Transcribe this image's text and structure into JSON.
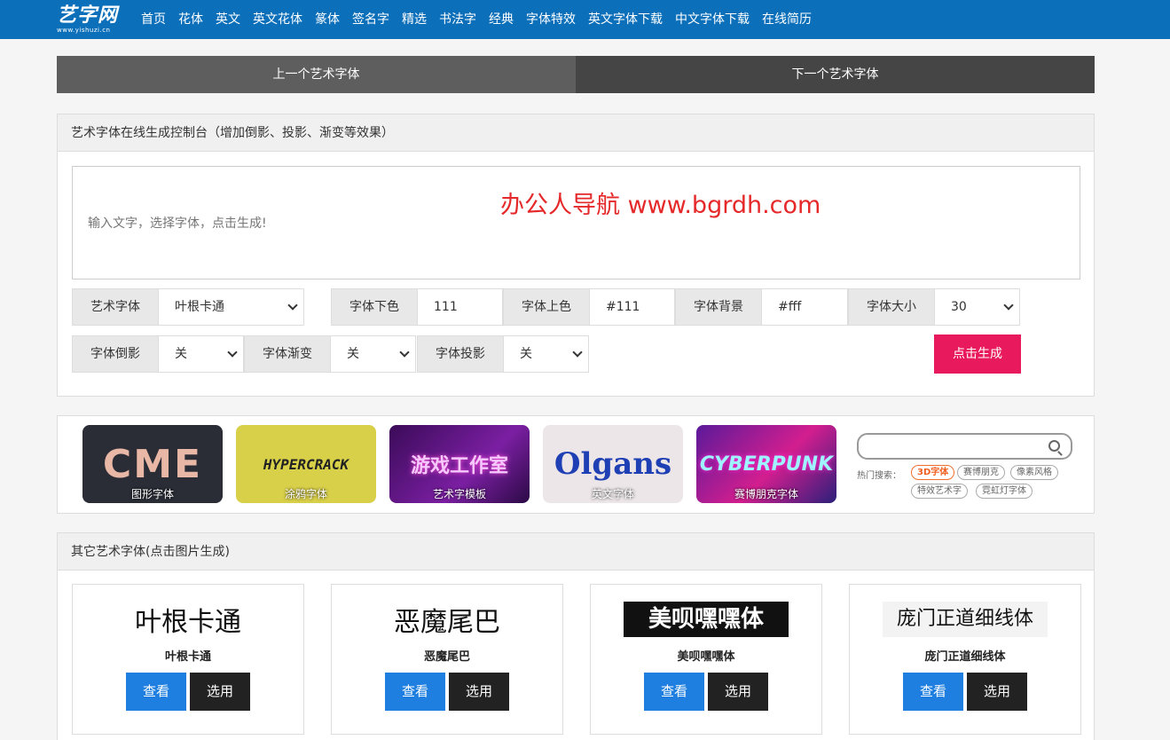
{
  "header": {
    "logo_text": "艺字网",
    "logo_sub": "www.yishuzi.cn",
    "nav": [
      "首页",
      "花体",
      "英文",
      "英文花体",
      "篆体",
      "签名字",
      "精选",
      "书法字",
      "经典",
      "字体特效",
      "英文字体下载",
      "中文字体下载",
      "在线简历"
    ]
  },
  "prevnext": {
    "prev": "上一个艺术字体",
    "next": "下一个艺术字体"
  },
  "console": {
    "title": "艺术字体在线生成控制台（增加倒影、投影、渐变等效果）",
    "input_placeholder": "输入文字，选择字体，点击生成!",
    "watermark": "办公人导航 www.bgrdh.com",
    "controls": {
      "font_label": "艺术字体",
      "font_value": "叶根卡通",
      "bottom_color_label": "字体下色",
      "bottom_color_value": "111",
      "top_color_label": "字体上色",
      "top_color_value": "#111",
      "bg_label": "字体背景",
      "bg_value": "#fff",
      "size_label": "字体大小",
      "size_value": "30",
      "reflection_label": "字体倒影",
      "reflection_value": "关",
      "gradient_label": "字体渐变",
      "gradient_value": "关",
      "shadow_label": "字体投影",
      "shadow_value": "关"
    },
    "generate_label": "点击生成"
  },
  "banner": {
    "thumbs": [
      {
        "art": "CME",
        "caption": "图形字体"
      },
      {
        "art": "HYPERCRACK",
        "caption": "涂鸦字体"
      },
      {
        "art": "游戏工作室",
        "caption": "艺术字模板"
      },
      {
        "art": "Olgans",
        "caption": "英文字体"
      },
      {
        "art": "CYBERPUNK",
        "caption": "赛博朋克字体"
      }
    ],
    "hot_label": "热门搜索：",
    "hot_tags": [
      "3D字体",
      "赛博朋克",
      "像素风格",
      "特效艺术字",
      "霓虹灯字体"
    ]
  },
  "others": {
    "title": "其它艺术字体(点击图片生成)",
    "view_label": "查看",
    "pick_label": "选用",
    "cards": [
      {
        "sample": "叶根卡通",
        "name": "叶根卡通"
      },
      {
        "sample": "恶魔尾巴",
        "name": "恶魔尾巴"
      },
      {
        "sample": "美呗嘿嘿体",
        "name": "美呗嘿嘿体"
      },
      {
        "sample": "庞门正道细线体",
        "name": "庞门正道细线体"
      }
    ]
  },
  "colors": {
    "nav_bg": "#0b6fba",
    "accent_pink": "#e8195c",
    "view_blue": "#1e7fe0",
    "watermark_red": "#e5282a"
  }
}
